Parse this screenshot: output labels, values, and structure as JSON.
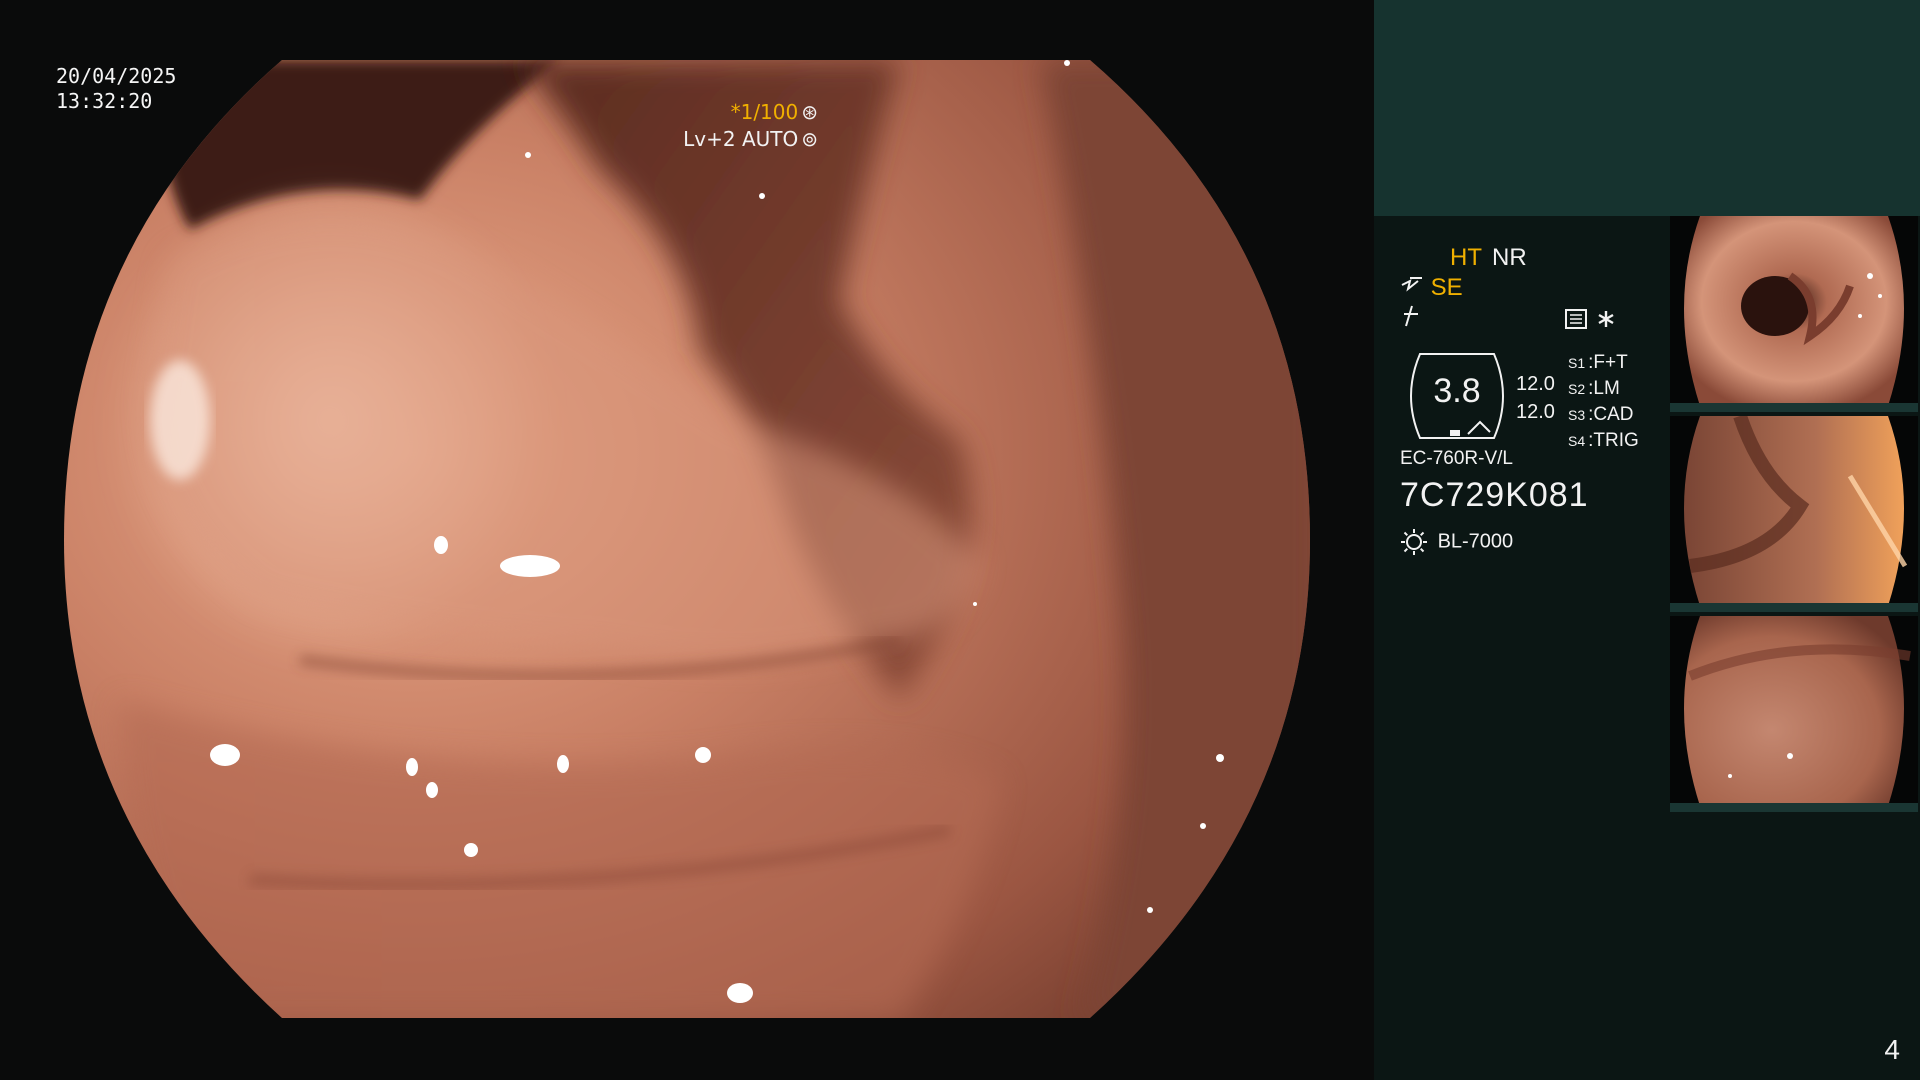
{
  "overlay": {
    "date": "20/04/2025",
    "time": "13:32:20",
    "shutter": "*1/100",
    "level": "Lv+2 AUTO"
  },
  "panel": {
    "mode_ht": "HT",
    "mode_nr": "NR",
    "mode_se": "SE",
    "scope_value": "3.8",
    "num_1": "12.0",
    "num_2": "12.0",
    "settings": [
      {
        "label": "S1",
        "value": "F+T"
      },
      {
        "label": "S2",
        "value": "LM"
      },
      {
        "label": "S3",
        "value": "CAD"
      },
      {
        "label": "S4",
        "value": "TRIG"
      }
    ],
    "scope_model": "EC-760R-V/L",
    "serial": "7C729K081",
    "light_source": "BL-7000",
    "page_number": "4"
  },
  "colors": {
    "accent_orange": "#f0b000",
    "panel_teal": "#16332f",
    "panel_dark": "#0b1614"
  },
  "icons": [
    "shutter-icon",
    "auto-iris-icon",
    "structure-enhance-icon",
    "freeze-icon",
    "menu-icon",
    "asterisk-icon",
    "light-source-icon"
  ]
}
